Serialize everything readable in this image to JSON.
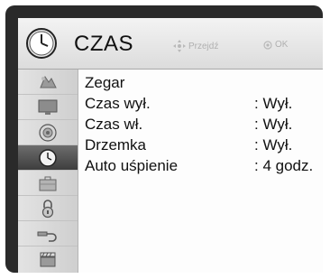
{
  "header": {
    "title": "CZAS",
    "hint_move": "Przejdź",
    "hint_ok": "OK",
    "icon": "clock-icon"
  },
  "sidebar": {
    "items": [
      {
        "icon": "image-icon",
        "active": false
      },
      {
        "icon": "tv-screen-icon",
        "active": false
      },
      {
        "icon": "sound-icon",
        "active": false
      },
      {
        "icon": "clock-icon",
        "active": true
      },
      {
        "icon": "briefcase-icon",
        "active": false
      },
      {
        "icon": "lock-icon",
        "active": false
      },
      {
        "icon": "input-cable-icon",
        "active": false
      },
      {
        "icon": "clapperboard-icon",
        "active": false
      }
    ]
  },
  "menu": {
    "rows": [
      {
        "label": "Zegar",
        "value": ""
      },
      {
        "label": "Czas wył.",
        "value": ": Wył."
      },
      {
        "label": "Czas wł.",
        "value": ": Wył."
      },
      {
        "label": "Drzemka",
        "value": ": Wył."
      },
      {
        "label": "Auto uśpienie",
        "value": ": 4 godz."
      }
    ]
  },
  "colors": {
    "frame": "#2a2a2a",
    "active_item": "#4a4a4a",
    "hint_text": "#b0b0b0"
  }
}
